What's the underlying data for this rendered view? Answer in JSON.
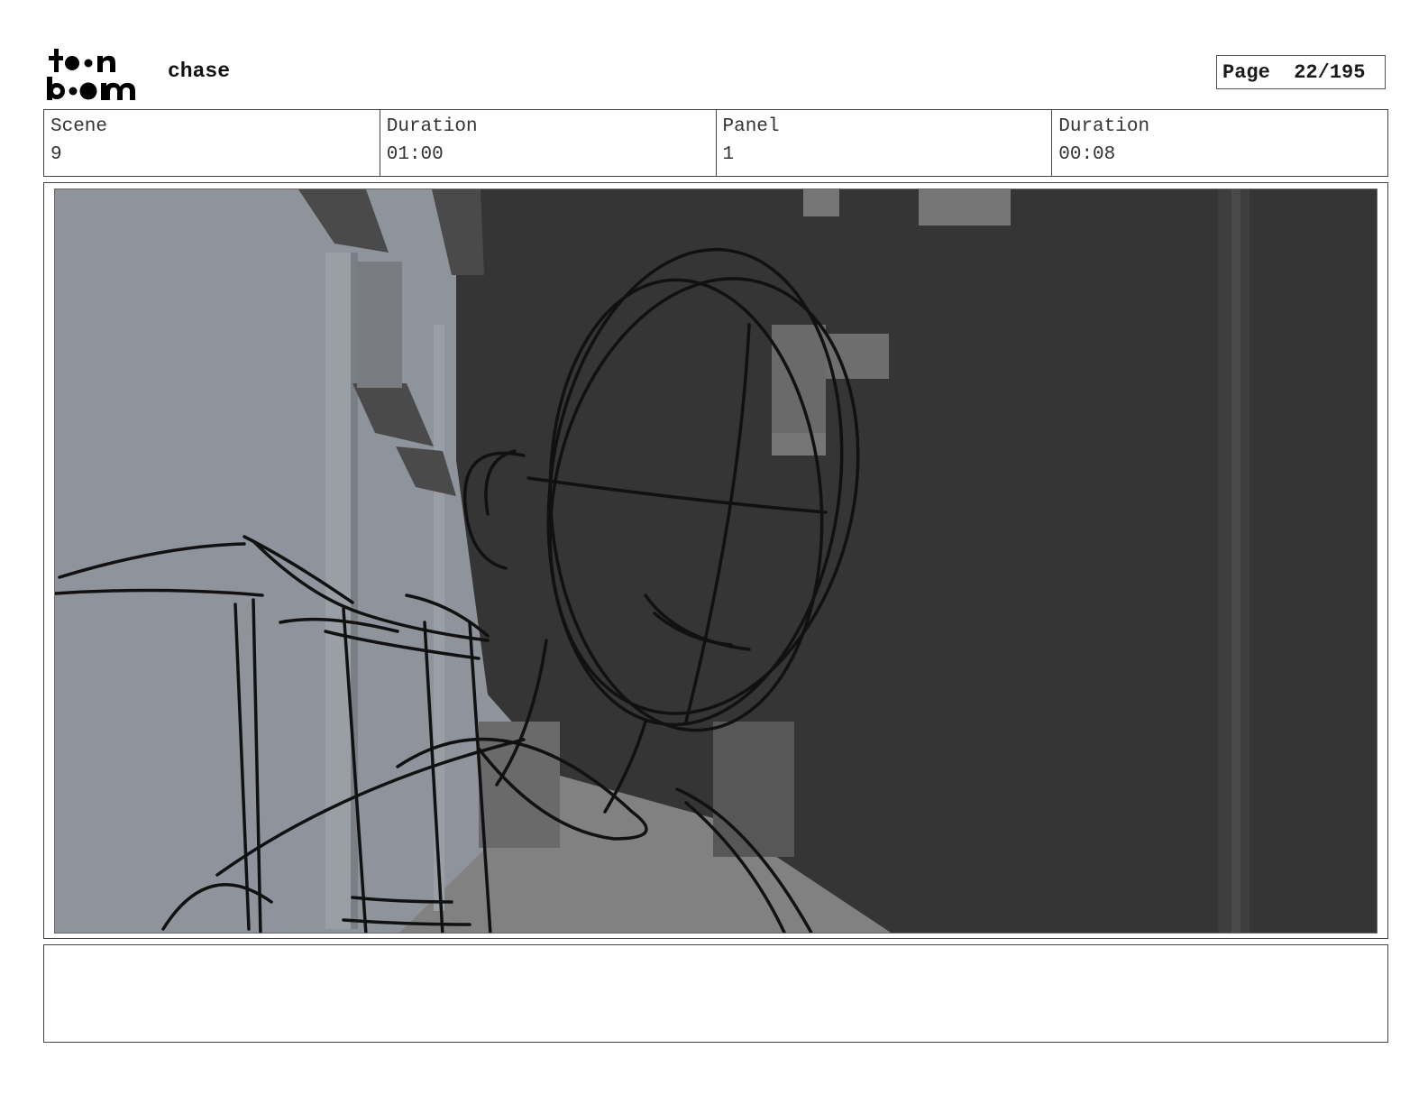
{
  "header": {
    "logo_text": "toon boom",
    "doc_title": "chase",
    "page_label": "Page",
    "page_value": "22/195"
  },
  "info": {
    "scene_label": "Scene",
    "scene_value": "9",
    "scene_duration_label": "Duration",
    "scene_duration_value": "01:00",
    "panel_label": "Panel",
    "panel_value": "1",
    "panel_duration_label": "Duration",
    "panel_duration_value": "00:08"
  },
  "notes": {
    "text": ""
  },
  "colors": {
    "left_wall": "#8f949c",
    "dark_wall": "#353535",
    "floor": "#818181",
    "sketch_line": "#111111"
  }
}
